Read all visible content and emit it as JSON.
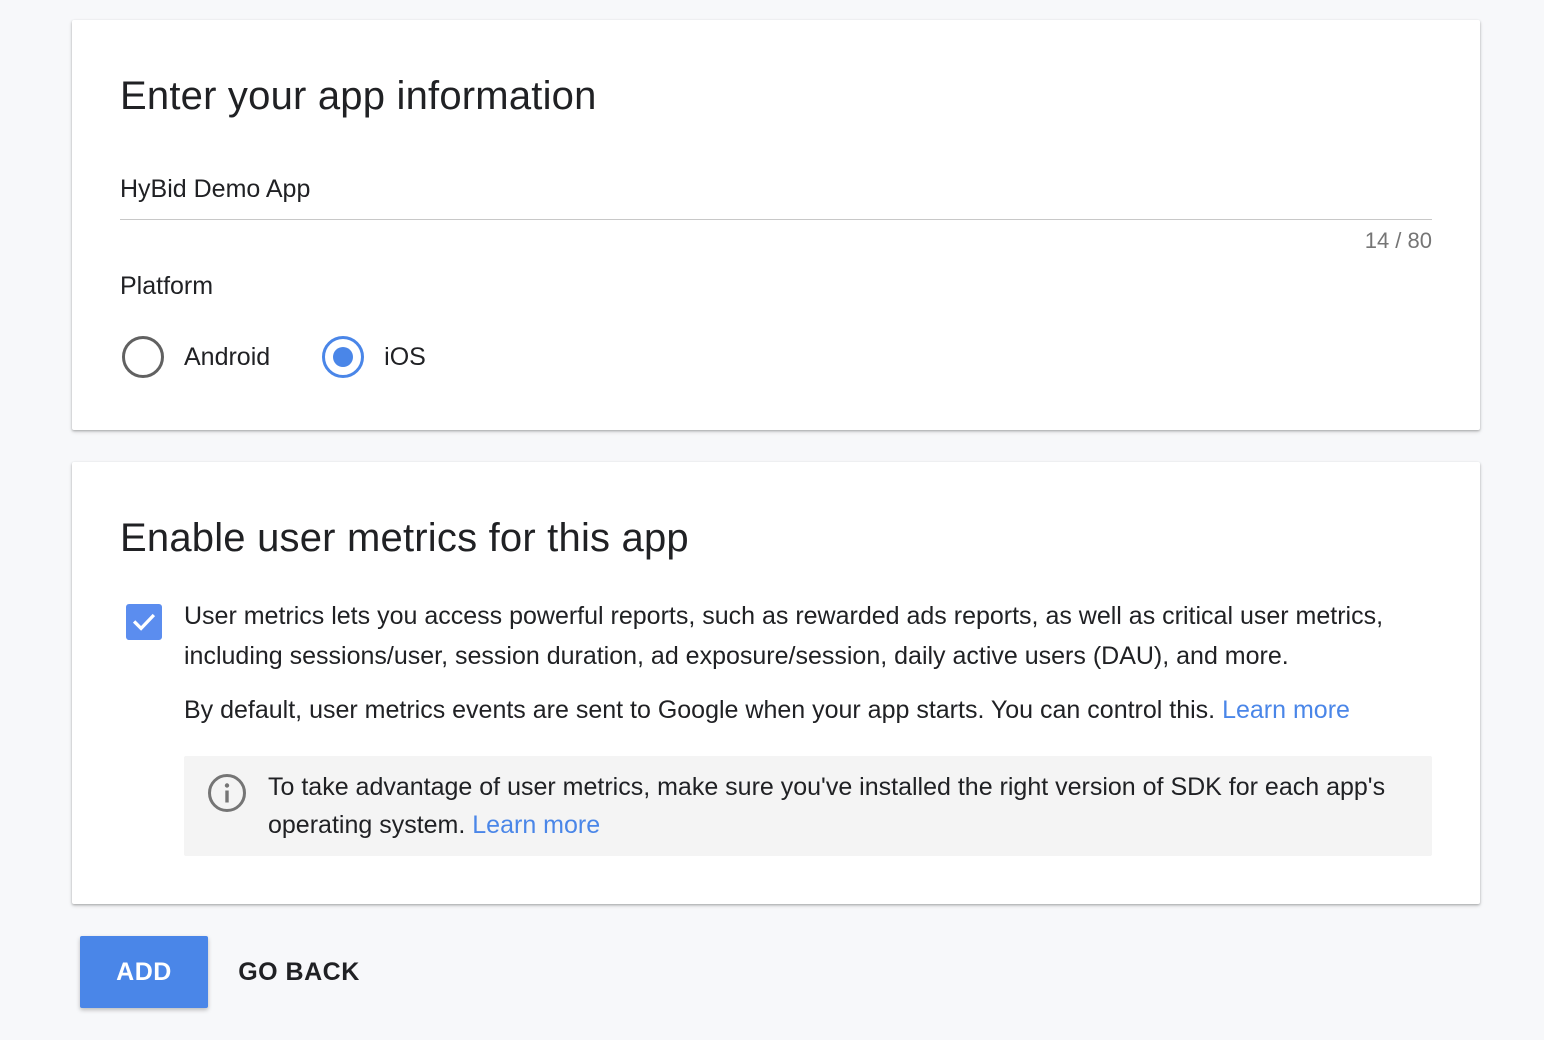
{
  "app_info": {
    "title": "Enter your app information",
    "app_name_value": "HyBid Demo App",
    "char_count": "14 / 80",
    "platform_label": "Platform",
    "platforms": [
      {
        "label": "Android",
        "selected": false
      },
      {
        "label": "iOS",
        "selected": true
      }
    ]
  },
  "user_metrics": {
    "title": "Enable user metrics for this app",
    "enabled": true,
    "description": "User metrics lets you access powerful reports, such as rewarded ads reports, as well as critical user metrics, including sessions/user, session duration, ad exposure/session, daily active users (DAU), and more.",
    "default_text": "By default, user metrics events are sent to Google when your app starts. You can control this.",
    "default_link": "Learn more",
    "info_text": "To take advantage of user metrics, make sure you've installed the right version of SDK for each app's operating system.",
    "info_link": "Learn more"
  },
  "actions": {
    "add_label": "ADD",
    "back_label": "GO BACK"
  },
  "colors": {
    "accent": "#4a86e8",
    "background": "#f7f8fa",
    "info_box": "#f4f4f4"
  },
  "icons": {
    "checkbox": "check-icon",
    "info": "info-icon"
  }
}
